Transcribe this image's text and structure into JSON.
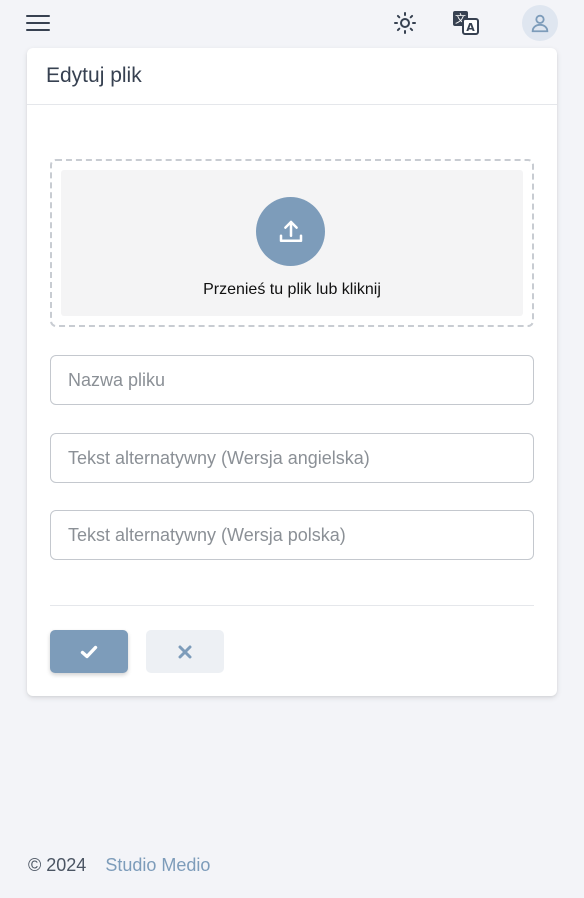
{
  "header": {
    "menu_icon": "hamburger-menu-icon",
    "theme_icon": "sun-icon",
    "language_icon": "translate-icon",
    "account_icon": "user-icon"
  },
  "dialog": {
    "title": "Edytuj plik",
    "dropzone": {
      "icon": "upload-icon",
      "label": "Przenieś tu plik lub kliknij"
    },
    "fields": {
      "file_name": {
        "placeholder": "Nazwa pliku",
        "value": ""
      },
      "alt_en": {
        "placeholder": "Tekst alternatywny (Wersja angielska)",
        "value": ""
      },
      "alt_pl": {
        "placeholder": "Tekst alternatywny (Wersja polska)",
        "value": ""
      }
    },
    "actions": {
      "confirm_icon": "check-icon",
      "cancel_icon": "close-icon"
    }
  },
  "footer": {
    "copyright": "© 2024",
    "link": "Studio Medio"
  },
  "colors": {
    "accent": "#7d9cba",
    "background": "#f3f4f8",
    "card": "#ffffff"
  }
}
